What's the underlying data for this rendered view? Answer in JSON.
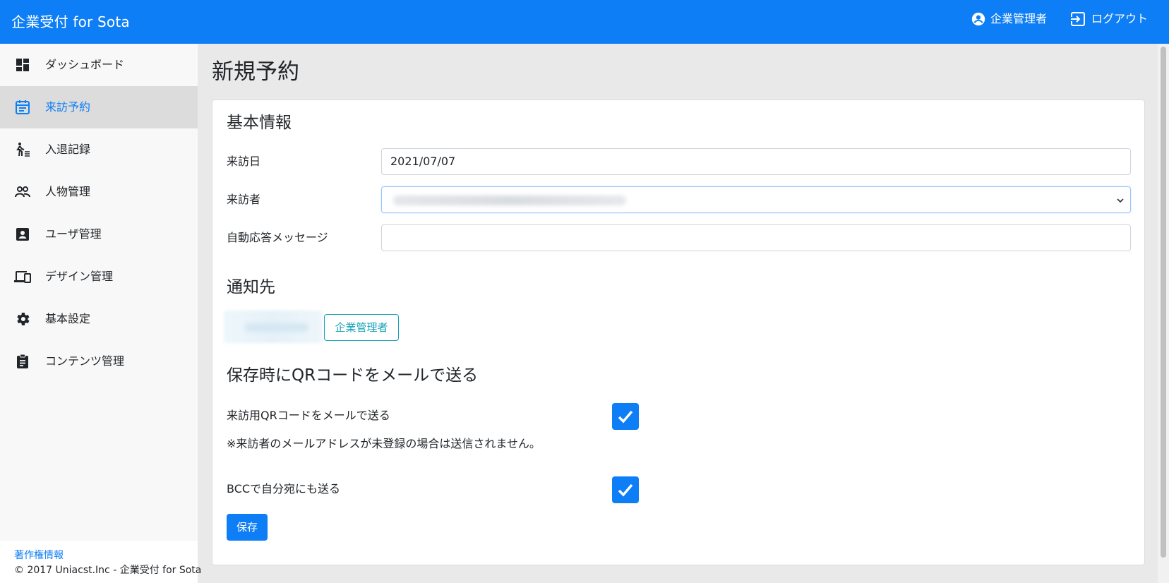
{
  "header": {
    "brand": "企業受付 for Sota",
    "user_label": "企業管理者",
    "logout_label": "ログアウト",
    "brand_color": "#0d7ef5"
  },
  "sidebar": {
    "items": [
      {
        "label": "ダッシュボード",
        "icon": "dashboard-icon",
        "active": false
      },
      {
        "label": "来訪予約",
        "icon": "calendar-icon",
        "active": true
      },
      {
        "label": "入退記録",
        "icon": "walking-person-icon",
        "active": false
      },
      {
        "label": "人物管理",
        "icon": "people-icon",
        "active": false
      },
      {
        "label": "ユーザ管理",
        "icon": "account-box-icon",
        "active": false
      },
      {
        "label": "デザイン管理",
        "icon": "devices-icon",
        "active": false
      },
      {
        "label": "基本設定",
        "icon": "gear-icon",
        "active": false
      },
      {
        "label": "コンテンツ管理",
        "icon": "clipboard-icon",
        "active": false
      }
    ],
    "footer": {
      "copyright_link": "著作権情報",
      "copyright_text": "© 2017 Uniacst.Inc - 企業受付 for Sota"
    }
  },
  "main": {
    "page_title": "新規予約",
    "basic_info": {
      "heading": "基本情報",
      "visit_date_label": "来訪日",
      "visit_date_value": "2021/07/07",
      "visitor_label": "来訪者",
      "auto_reply_label": "自動応答メッセージ",
      "auto_reply_value": ""
    },
    "notify": {
      "heading": "通知先",
      "button_label": "企業管理者"
    },
    "qr": {
      "heading": "保存時にQRコードをメールで送る",
      "send_qr_label": "来訪用QRコードをメールで送る",
      "send_qr_checked": true,
      "note": "※来訪者のメールアドレスが未登録の場合は送信されません。",
      "bcc_label": "BCCで自分宛にも送る",
      "bcc_checked": true
    },
    "save_label": "保存"
  }
}
